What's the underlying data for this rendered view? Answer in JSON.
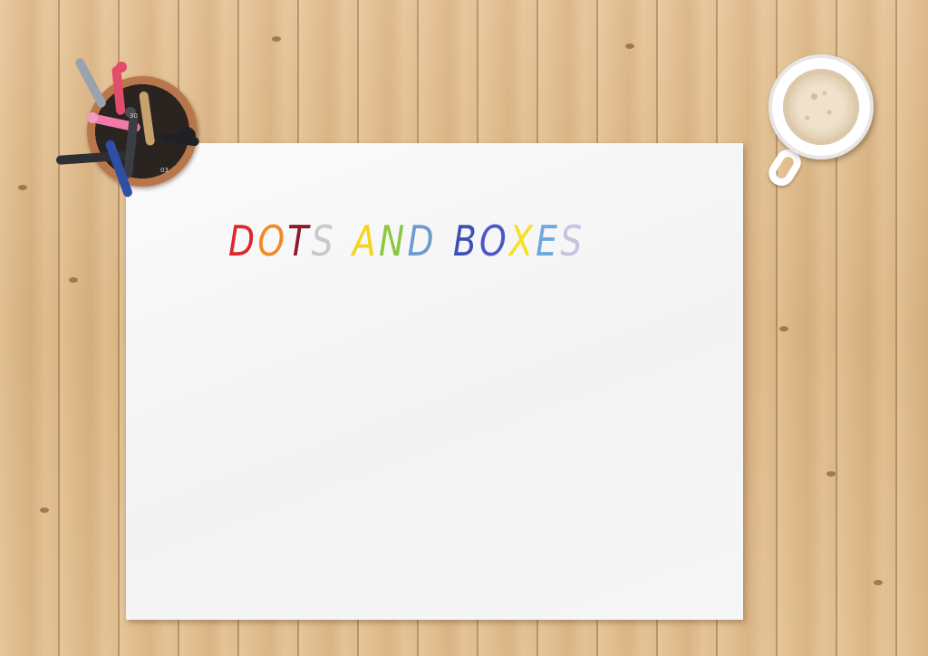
{
  "game": {
    "title_letters": [
      {
        "char": "D",
        "color": "#e0262b"
      },
      {
        "char": "O",
        "color": "#f08b24"
      },
      {
        "char": "T",
        "color": "#8c1a2b"
      },
      {
        "char": "S",
        "color": "#c9c9c9"
      },
      {
        "char": "A",
        "color": "#f5d31b"
      },
      {
        "char": "N",
        "color": "#8dc63f"
      },
      {
        "char": "D",
        "color": "#6a9bd1"
      },
      {
        "char": "B",
        "color": "#3f4fb8"
      },
      {
        "char": "O",
        "color": "#4b57c8"
      },
      {
        "char": "X",
        "color": "#f5e020"
      },
      {
        "char": "E",
        "color": "#6fa8dc"
      },
      {
        "char": "S",
        "color": "#c9c3e3"
      }
    ]
  },
  "desk_items": {
    "cup_icon": "pencil-cup",
    "mug_icon": "coffee-mug",
    "pen_labels": [
      "30",
      "03"
    ]
  }
}
